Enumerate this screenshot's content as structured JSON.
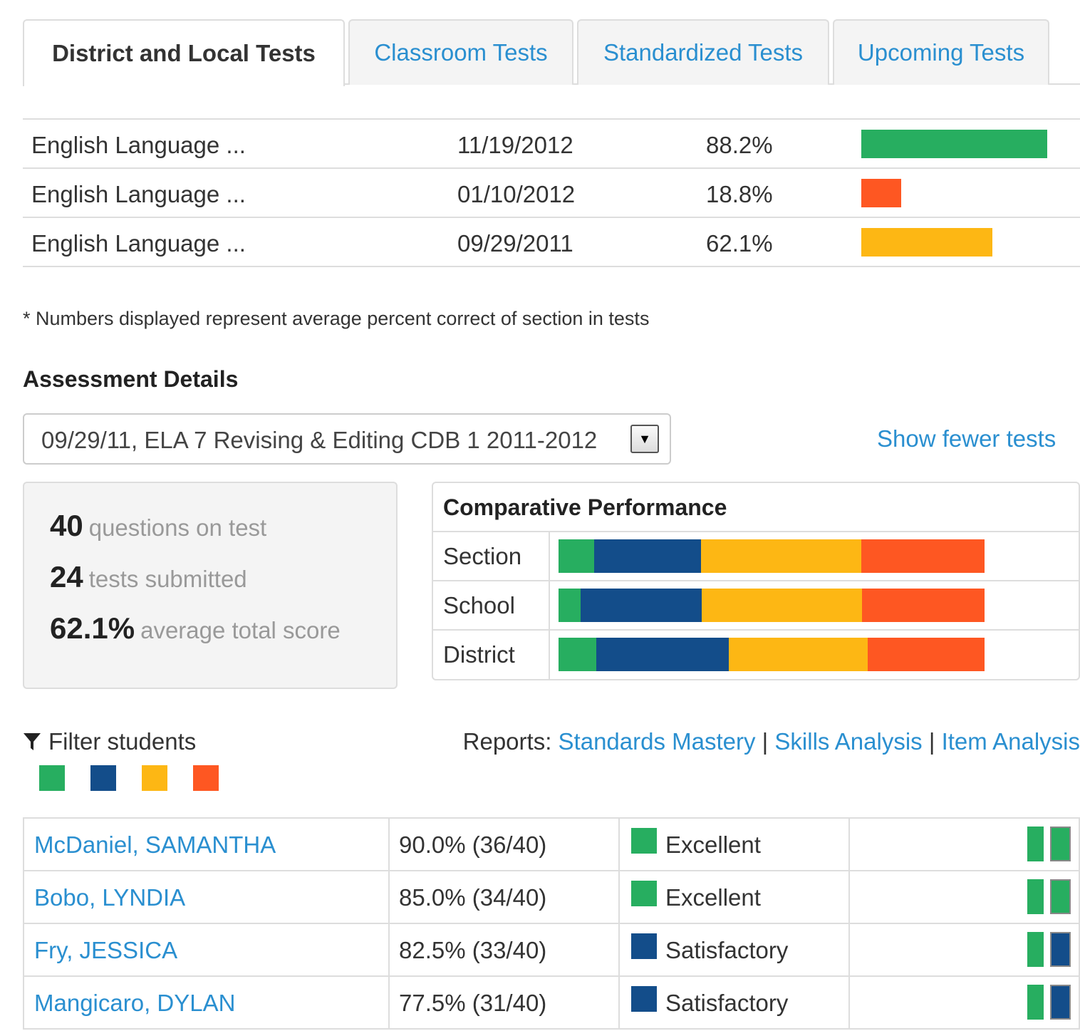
{
  "tabs": [
    {
      "label": "District and Local Tests",
      "active": true
    },
    {
      "label": "Classroom Tests",
      "active": false
    },
    {
      "label": "Standardized Tests",
      "active": false
    },
    {
      "label": "Upcoming Tests",
      "active": false
    }
  ],
  "colors": {
    "excellent": "#27ae60",
    "satisfactory": "#134d8a",
    "fair": "#fdb714",
    "poor": "#fe5722",
    "link": "#2a8fd0"
  },
  "tests": [
    {
      "name": "English Language ...",
      "date": "11/19/2012",
      "percent": "88.2%",
      "value": 88.2,
      "color": "#27ae60"
    },
    {
      "name": "English Language ...",
      "date": "01/10/2012",
      "percent": "18.8%",
      "value": 18.8,
      "color": "#fe5722"
    },
    {
      "name": "English Language ...",
      "date": "09/29/2011",
      "percent": "62.1%",
      "value": 62.1,
      "color": "#fdb714"
    }
  ],
  "note": "* Numbers displayed represent average percent correct of section in tests",
  "assessment": {
    "title": "Assessment Details",
    "selected_test": "09/29/11, ELA 7 Revising & Editing CDB 1 2011-2012",
    "show_fewer": "Show fewer tests"
  },
  "stats": {
    "questions_num": "40",
    "questions_label": "questions on test",
    "submitted_num": "24",
    "submitted_label": "tests submitted",
    "average_num": "62.1%",
    "average_label": "average total score"
  },
  "comparative": {
    "title": "Comparative Performance",
    "rows": [
      {
        "label": "Section",
        "segments": [
          8.4,
          25.0,
          37.6,
          29.0
        ]
      },
      {
        "label": "School",
        "segments": [
          5.2,
          28.4,
          37.6,
          28.8
        ]
      },
      {
        "label": "District",
        "segments": [
          8.9,
          31.1,
          32.6,
          27.4
        ]
      }
    ]
  },
  "filter": {
    "label": "Filter students"
  },
  "reports": {
    "prefix": "Reports:",
    "links": [
      "Standards Mastery",
      "Skills Analysis",
      "Item Analysis"
    ],
    "separator": "|"
  },
  "students": [
    {
      "name": "McDaniel, SAMANTHA",
      "score": "90.0% (36/40)",
      "level": "Excellent",
      "level_color": "#27ae60",
      "mini": [
        "#27ae60",
        "#27ae60"
      ]
    },
    {
      "name": "Bobo, LYNDIA",
      "score": "85.0% (34/40)",
      "level": "Excellent",
      "level_color": "#27ae60",
      "mini": [
        "#27ae60",
        "#27ae60"
      ]
    },
    {
      "name": "Fry, JESSICA",
      "score": "82.5% (33/40)",
      "level": "Satisfactory",
      "level_color": "#134d8a",
      "mini": [
        "#27ae60",
        "#134d8a"
      ]
    },
    {
      "name": "Mangicaro, DYLAN",
      "score": "77.5% (31/40)",
      "level": "Satisfactory",
      "level_color": "#134d8a",
      "mini": [
        "#27ae60",
        "#134d8a"
      ]
    }
  ]
}
